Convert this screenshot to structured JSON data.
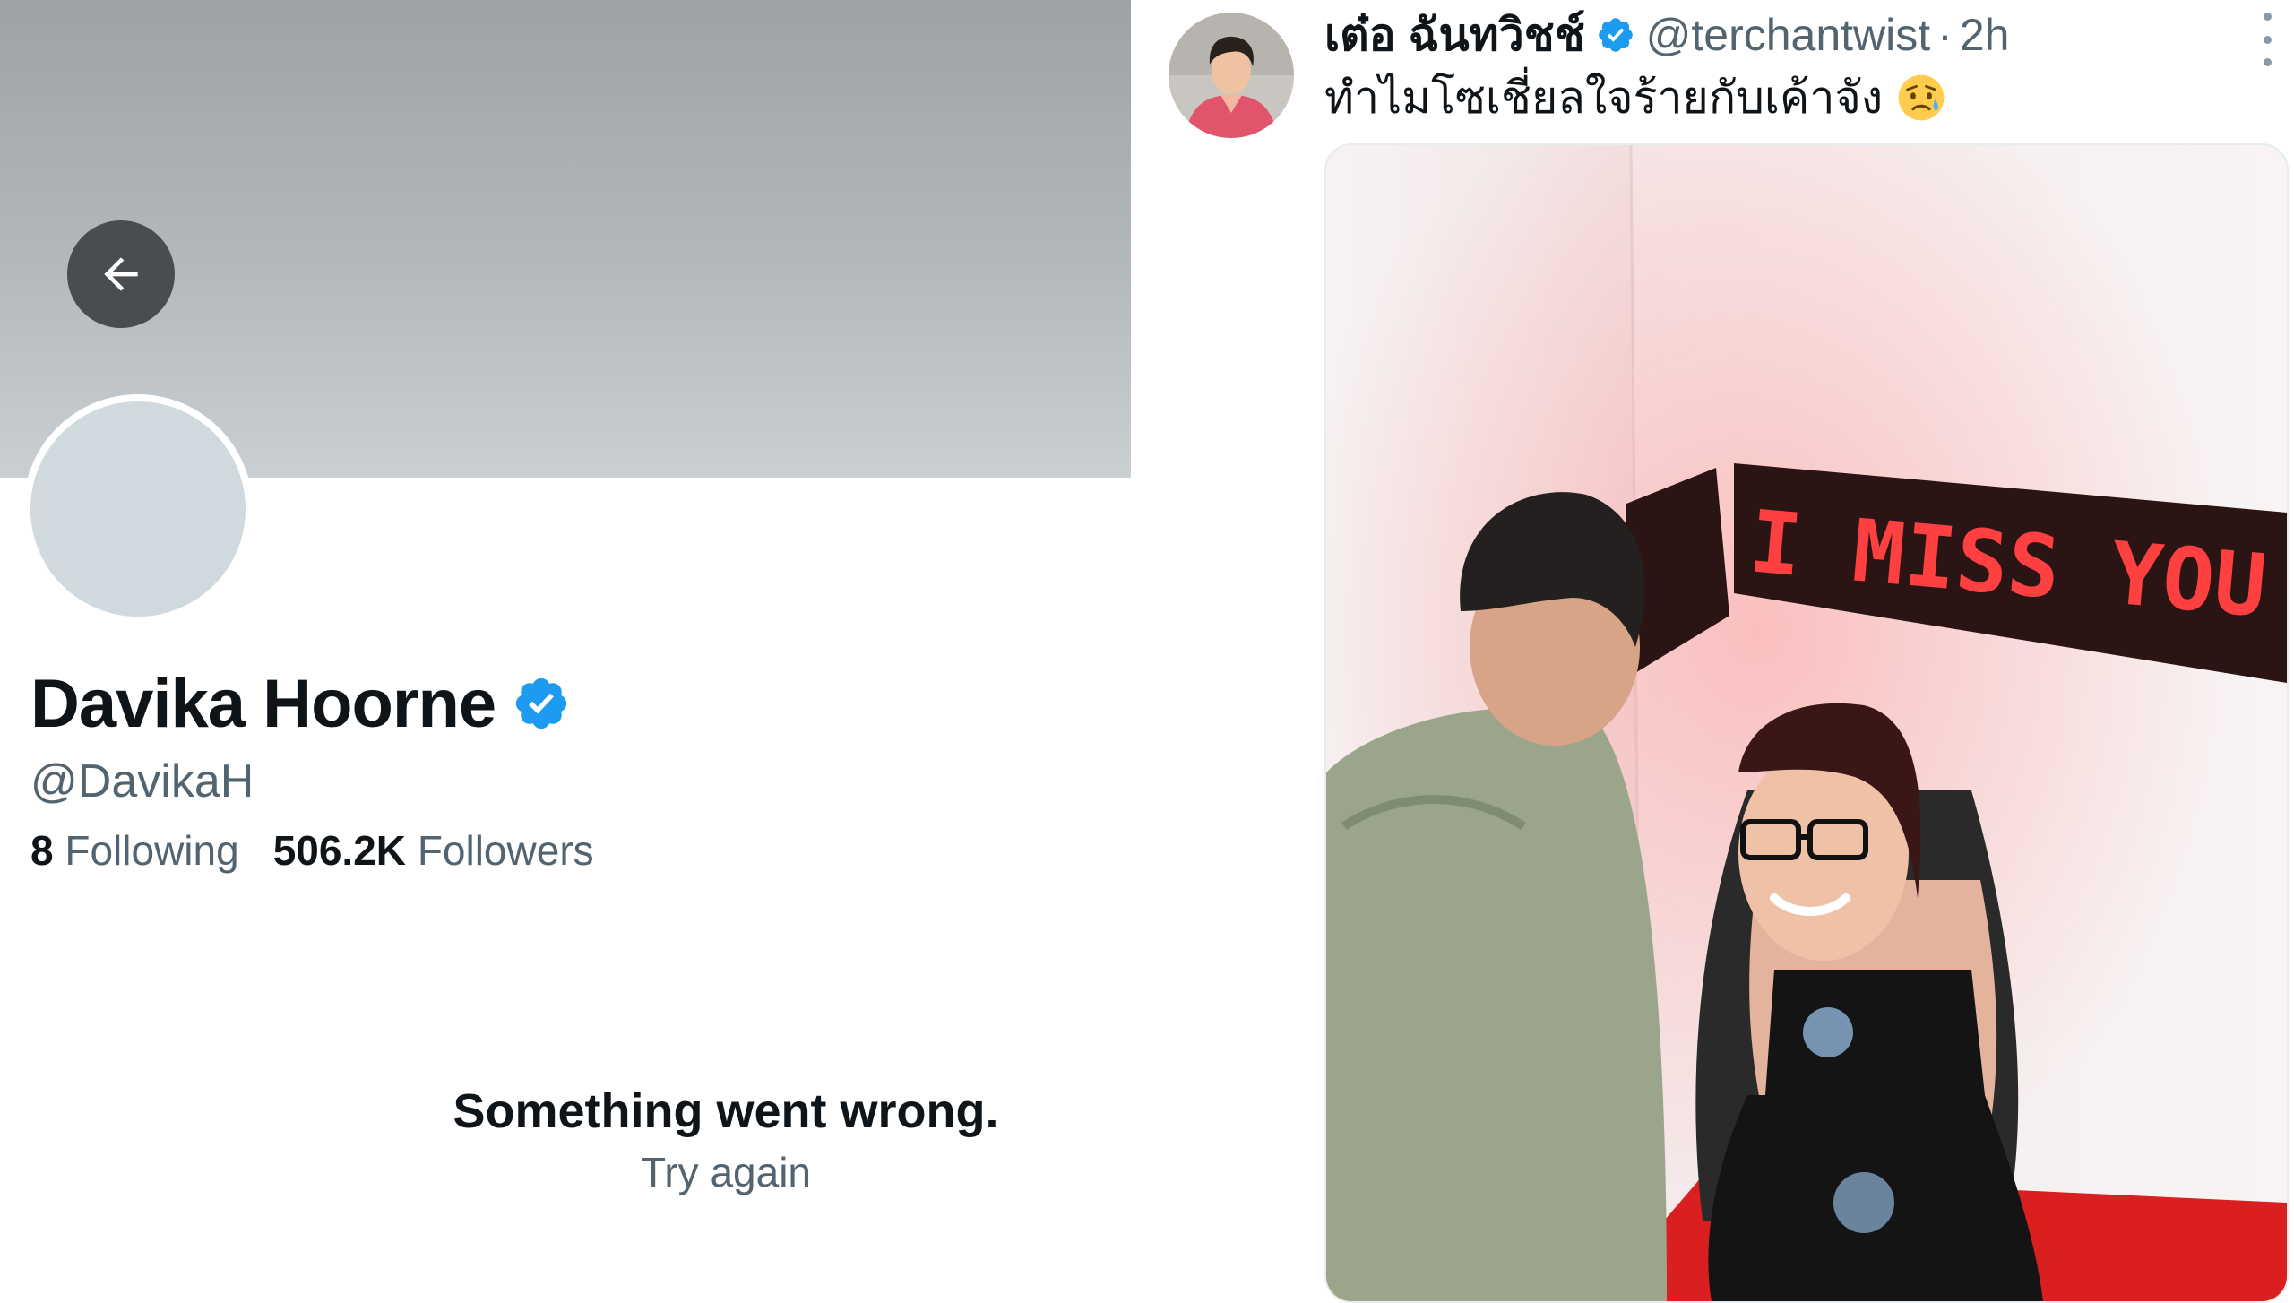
{
  "profile": {
    "back_icon": "arrow-left-icon",
    "display_name": "Davika Hoorne",
    "handle": "@DavikaH",
    "following_count": "8",
    "following_label": "Following",
    "followers_count": "506.2K",
    "followers_label": "Followers",
    "error_title": "Something went wrong.",
    "retry_label": "Try again",
    "verified_icon": "verified-badge-icon",
    "colors": {
      "verified": "#1d9bf0",
      "primary_text": "#0f1419",
      "secondary_text": "#536471"
    }
  },
  "tweet": {
    "author_name": "เต๋อ ฉันทวิชช์",
    "author_handle": "@terchantwist",
    "separator": "·",
    "time": "2h",
    "text": "ทำไมโซเชี่ยลใจร้ายกับเค้าจัง",
    "emoji": "sad-relieved-face",
    "more_icon": "more-vertical-icon",
    "media_led_text": "I MISS YOU I M"
  }
}
